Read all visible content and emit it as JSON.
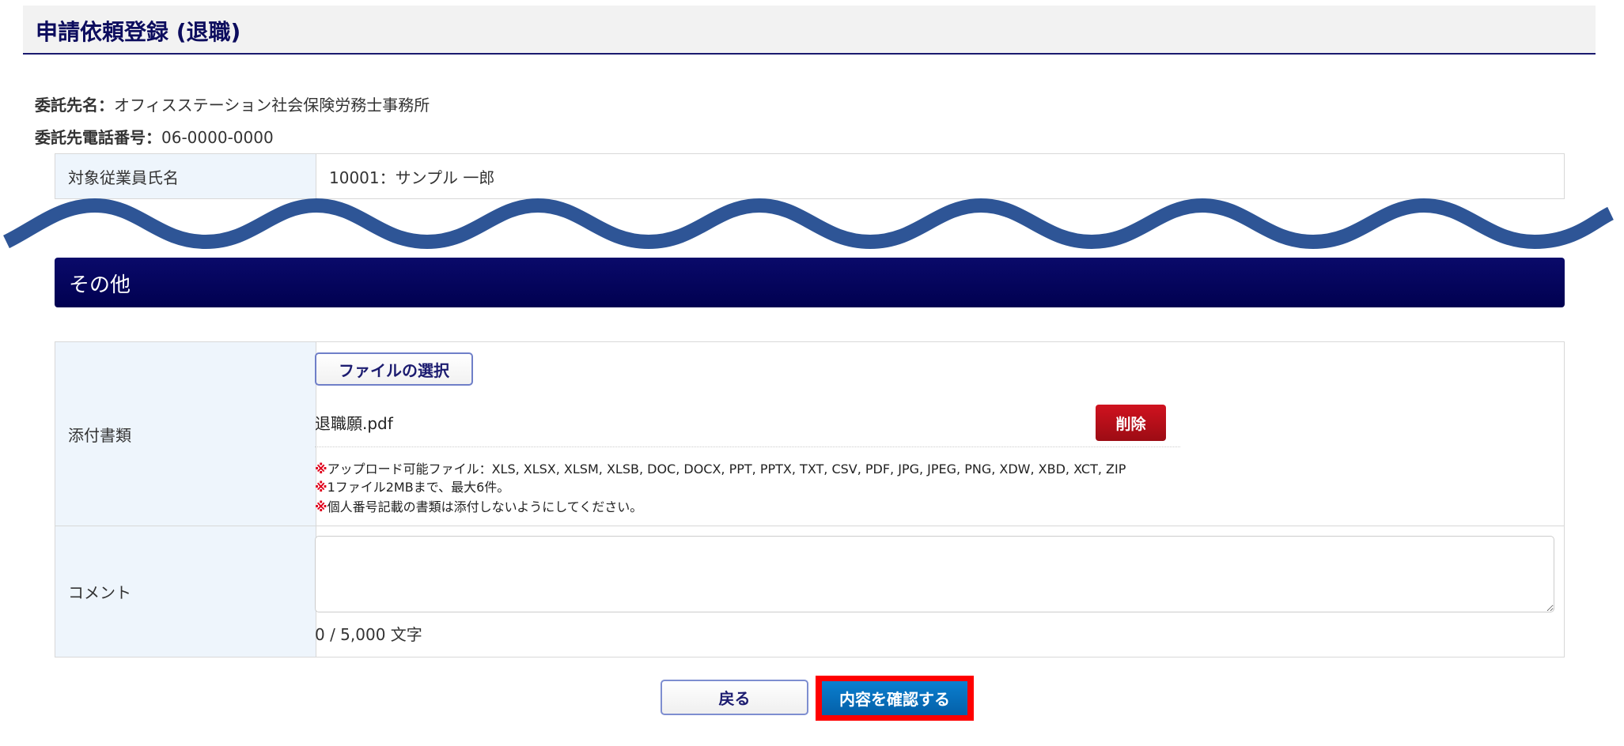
{
  "header": {
    "title": "申請依頼登録 (退職)"
  },
  "info": {
    "contractor_label": "委託先名：",
    "contractor": "オフィスステーション社会保険労務士事務所",
    "phone_label": "委託先電話番号：",
    "phone": "06-0000-0000"
  },
  "employee": {
    "label": "対象従業員氏名",
    "value": "10001：サンプル 一郎"
  },
  "section": {
    "title": "その他"
  },
  "attachments": {
    "label": "添付書類",
    "choose_button": "ファイルの選択",
    "file_name": "退職願.pdf",
    "delete_button": "削除",
    "note_mark": "※",
    "notes": [
      "アップロード可能ファイル：XLS, XLSX, XLSM, XLSB, DOC, DOCX, PPT, PPTX, TXT, CSV, PDF, JPG, JPEG, PNG, XDW, XBD, XCT, ZIP",
      "1ファイル2MBまで、最大6件。",
      "個人番号記載の書類は添付しないようにしてください。"
    ]
  },
  "comment": {
    "label": "コメント",
    "value": "",
    "counter": "0 / 5,000 文字"
  },
  "footer": {
    "back_button": "戻る",
    "confirm_button": "内容を確認する"
  },
  "colors": {
    "wave": "#2e5596",
    "highlight": "#ff0000"
  }
}
